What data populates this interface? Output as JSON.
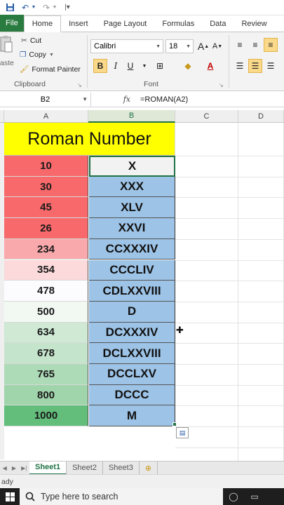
{
  "qat": {
    "save_icon": "save-icon",
    "undo_icon": "undo-icon",
    "redo_icon": "redo-icon",
    "customize_icon": "customize-icon"
  },
  "tabs": [
    "File",
    "Home",
    "Insert",
    "Page Layout",
    "Formulas",
    "Data",
    "Review"
  ],
  "clipboard": {
    "cut": "Cut",
    "copy": "Copy",
    "format_painter": "Format Painter",
    "paste": "aste",
    "group": "Clipboard"
  },
  "font": {
    "name": "Calibri",
    "size": "18",
    "bold": "B",
    "italic": "I",
    "underline": "U",
    "group": "Font",
    "grow": "A",
    "shrink": "A"
  },
  "formula_bar": {
    "name_box": "B2",
    "fx": "fx",
    "formula": "=ROMAN(A2)"
  },
  "columns": [
    "A",
    "B",
    "C",
    "D"
  ],
  "table": {
    "title": "Roman Number",
    "rows": [
      {
        "number": "10",
        "roman": "X",
        "color": "#f8696b"
      },
      {
        "number": "30",
        "roman": "XXX",
        "color": "#f8696b"
      },
      {
        "number": "45",
        "roman": "XLV",
        "color": "#f8696b"
      },
      {
        "number": "26",
        "roman": "XXVI",
        "color": "#f8696b"
      },
      {
        "number": "234",
        "roman": "CCXXXIV",
        "color": "#f9a9ab"
      },
      {
        "number": "354",
        "roman": "CCCLIV",
        "color": "#fcd9da"
      },
      {
        "number": "478",
        "roman": "CDLXXVIII",
        "color": "#fcfcff"
      },
      {
        "number": "500",
        "roman": "D",
        "color": "#f2f9f3"
      },
      {
        "number": "634",
        "roman": "DCXXXIV",
        "color": "#cfe9d5"
      },
      {
        "number": "678",
        "roman": "DCLXXVIII",
        "color": "#c5e4cc"
      },
      {
        "number": "765",
        "roman": "DCCLXV",
        "color": "#addbb8"
      },
      {
        "number": "800",
        "roman": "DCCC",
        "color": "#a0d5ac"
      },
      {
        "number": "1000",
        "roman": "M",
        "color": "#63be7b"
      }
    ]
  },
  "sheets": [
    "Sheet1",
    "Sheet2",
    "Sheet3"
  ],
  "status": "ady",
  "taskbar": {
    "search_placeholder": "Type here to search"
  }
}
